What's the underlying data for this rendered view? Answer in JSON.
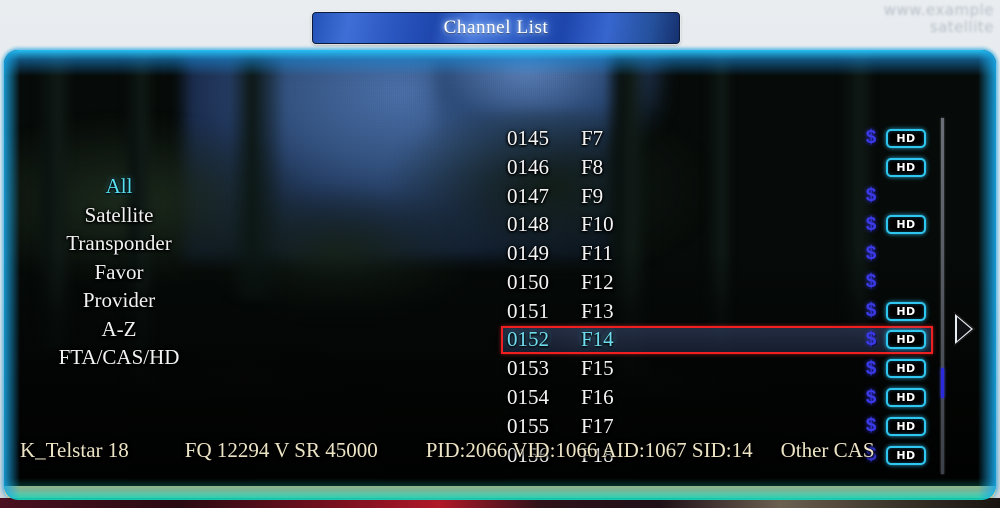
{
  "header": {
    "title": "Channel List",
    "watermark": "www.example\nsatellite"
  },
  "sidebar": {
    "items": [
      {
        "label": "All",
        "selected": true
      },
      {
        "label": "Satellite",
        "selected": false
      },
      {
        "label": "Transponder",
        "selected": false
      },
      {
        "label": "Favor",
        "selected": false
      },
      {
        "label": "Provider",
        "selected": false
      },
      {
        "label": "A-Z",
        "selected": false
      },
      {
        "label": "FTA/CAS/HD",
        "selected": false
      }
    ]
  },
  "channel_list": {
    "hd_badge_label": "HD",
    "scrambled_symbol": "$",
    "rows": [
      {
        "number": "0145",
        "name": "F7",
        "scrambled": true,
        "hd": true,
        "selected": false
      },
      {
        "number": "0146",
        "name": "F8",
        "scrambled": false,
        "hd": true,
        "selected": false
      },
      {
        "number": "0147",
        "name": "F9",
        "scrambled": true,
        "hd": false,
        "selected": false
      },
      {
        "number": "0148",
        "name": "F10",
        "scrambled": true,
        "hd": true,
        "selected": false
      },
      {
        "number": "0149",
        "name": "F11",
        "scrambled": true,
        "hd": false,
        "selected": false
      },
      {
        "number": "0150",
        "name": "F12",
        "scrambled": true,
        "hd": false,
        "selected": false
      },
      {
        "number": "0151",
        "name": "F13",
        "scrambled": true,
        "hd": true,
        "selected": false
      },
      {
        "number": "0152",
        "name": "F14",
        "scrambled": true,
        "hd": true,
        "selected": true
      },
      {
        "number": "0153",
        "name": "F15",
        "scrambled": true,
        "hd": true,
        "selected": false
      },
      {
        "number": "0154",
        "name": "F16",
        "scrambled": true,
        "hd": true,
        "selected": false
      },
      {
        "number": "0155",
        "name": "F17",
        "scrambled": true,
        "hd": true,
        "selected": false
      },
      {
        "number": "0156",
        "name": "F18",
        "scrambled": true,
        "hd": true,
        "selected": false
      }
    ]
  },
  "status_bar": {
    "satellite": "K_Telstar 18",
    "tuning": "FQ 12294 V SR 45000",
    "pids": "PID:2066 VID:1066 AID:1067 SID:14",
    "cas": "Other CAS"
  },
  "colors": {
    "selected_text": "#57e0f2",
    "highlight_border": "#f02020",
    "hd_border": "#2fc6ef",
    "scrambled": "#3a3ae8",
    "status_text": "#ece3c4",
    "frame_glow": "#14b4eb"
  },
  "icons": {
    "next_page": "right-triangle"
  }
}
